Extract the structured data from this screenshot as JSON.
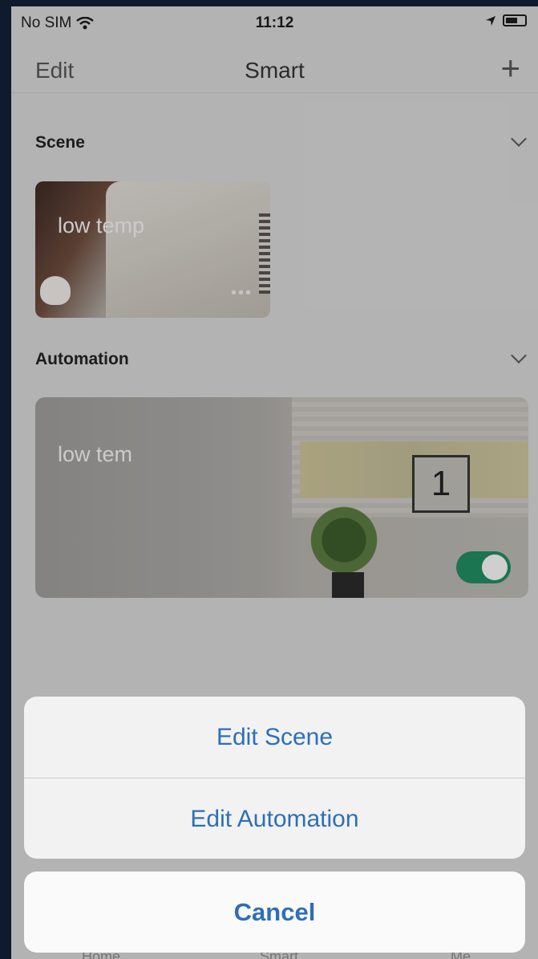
{
  "status_bar": {
    "carrier": "No SIM",
    "time": "11:12"
  },
  "nav": {
    "edit_label": "Edit",
    "title": "Smart",
    "add_symbol": "+"
  },
  "scene_section": {
    "title": "Scene",
    "cards": [
      {
        "label": "low temp",
        "more": "•••"
      }
    ]
  },
  "automation_section": {
    "title": "Automation",
    "cards": [
      {
        "label": "low tem",
        "clock_number": "1",
        "enabled": true
      }
    ]
  },
  "tab_bar": {
    "items": [
      "Home",
      "Smart",
      "Me"
    ]
  },
  "action_sheet": {
    "items": [
      "Edit Scene",
      "Edit Automation"
    ],
    "cancel_label": "Cancel"
  },
  "colors": {
    "accent": "#2f6fb5",
    "toggle_on": "#1f8a5e"
  },
  "icons": {
    "wifi": "wifi-icon",
    "location": "location-icon",
    "battery": "battery-icon",
    "chevron": "chevron-down-icon",
    "add": "plus-icon"
  }
}
